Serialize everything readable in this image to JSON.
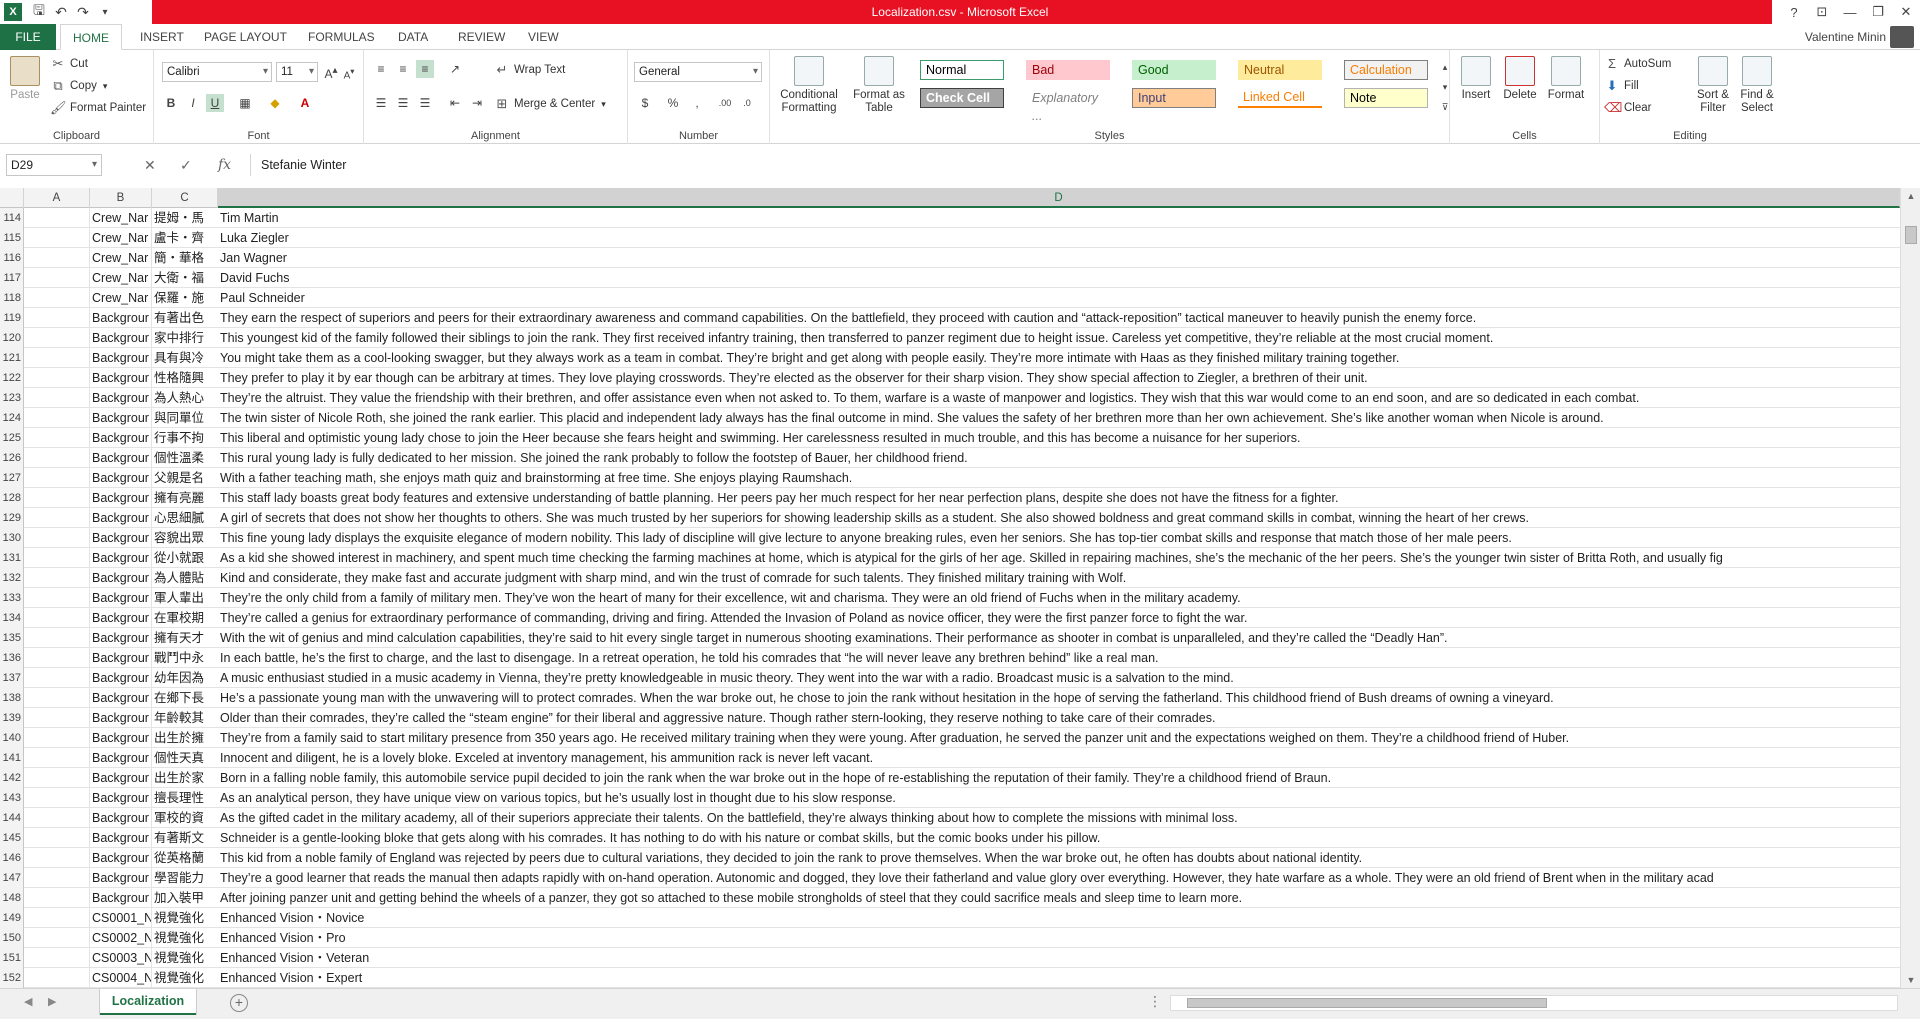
{
  "window": {
    "title": "Localization.csv - Microsoft Excel",
    "user_name": "Valentine Minin"
  },
  "ribbon_tabs": [
    "FILE",
    "HOME",
    "INSERT",
    "PAGE LAYOUT",
    "FORMULAS",
    "DATA",
    "REVIEW",
    "VIEW"
  ],
  "ribbon": {
    "clipboard": {
      "paste": "Paste",
      "cut": "Cut",
      "copy": "Copy",
      "format_painter": "Format Painter",
      "label": "Clipboard"
    },
    "font": {
      "name": "Calibri",
      "size": "11",
      "bold": "B",
      "italic": "I",
      "underline": "U",
      "label": "Font"
    },
    "alignment": {
      "wrap_text": "Wrap Text",
      "merge_center": "Merge & Center",
      "label": "Alignment"
    },
    "number": {
      "format": "General",
      "label": "Number"
    },
    "styles": {
      "conditional_formatting": "Conditional Formatting",
      "format_as_table": "Format as Table",
      "label": "Styles",
      "gallery": [
        {
          "name": "Normal",
          "bg": "#ffffff",
          "fg": "#000000",
          "border": "#3c9c6c"
        },
        {
          "name": "Bad",
          "bg": "#ffc7ce",
          "fg": "#9c0006",
          "border": "#ffc7ce"
        },
        {
          "name": "Good",
          "bg": "#c6efce",
          "fg": "#006100",
          "border": "#c6efce"
        },
        {
          "name": "Neutral",
          "bg": "#ffeb9c",
          "fg": "#9c5700",
          "border": "#ffeb9c"
        },
        {
          "name": "Calculation",
          "bg": "#f2f2f2",
          "fg": "#fa7d00",
          "border": "#7f7f7f"
        },
        {
          "name": "Check Cell",
          "bg": "#a5a5a5",
          "fg": "#ffffff",
          "border": "#3f3f3f"
        },
        {
          "name": "Explanatory ...",
          "bg": "#ffffff",
          "fg": "#7f7f7f",
          "border": "#ffffff"
        },
        {
          "name": "Input",
          "bg": "#ffcc99",
          "fg": "#3f3f76",
          "border": "#7f7f7f"
        },
        {
          "name": "Linked Cell",
          "bg": "#ffffff",
          "fg": "#fa7d00",
          "border": "#ff8001"
        },
        {
          "name": "Note",
          "bg": "#ffffcc",
          "fg": "#000000",
          "border": "#b2b2b2"
        }
      ]
    },
    "cells": {
      "insert": "Insert",
      "delete": "Delete",
      "format": "Format",
      "label": "Cells"
    },
    "editing": {
      "autosum": "AutoSum",
      "fill": "Fill",
      "clear": "Clear",
      "sort_filter": "Sort & Filter",
      "find_select": "Find & Select",
      "label": "Editing"
    }
  },
  "formula_bar": {
    "name_box": "D29",
    "fx": "fx",
    "content": "Stefanie Winter"
  },
  "columns": [
    "A",
    "B",
    "C",
    "D"
  ],
  "rows": [
    {
      "n": "114",
      "b": "Crew_Nar",
      "c": "提姆・馬",
      "d": "Tim Martin"
    },
    {
      "n": "115",
      "b": "Crew_Nar",
      "c": "盧卡・齊",
      "d": "Luka Ziegler"
    },
    {
      "n": "116",
      "b": "Crew_Nar",
      "c": "簡・華格",
      "d": "Jan Wagner"
    },
    {
      "n": "117",
      "b": "Crew_Nar",
      "c": "大衛・福",
      "d": "David Fuchs"
    },
    {
      "n": "118",
      "b": "Crew_Nar",
      "c": "保羅・施",
      "d": "Paul Schneider"
    },
    {
      "n": "119",
      "b": "Backgrour",
      "c": "有著出色",
      "d": "They earn the respect of superiors and peers for their extraordinary awareness and command capabilities.  On the battlefield, they proceed with caution and “attack-reposition” tactical maneuver to heavily punish the enemy force."
    },
    {
      "n": "120",
      "b": "Backgrour",
      "c": "家中排行",
      "d": "This youngest kid of the family followed their siblings to join the rank. They first received infantry training, then transferred to panzer regiment due to height issue.  Careless yet competitive, they’re reliable at the most crucial moment."
    },
    {
      "n": "121",
      "b": "Backgrour",
      "c": "具有與冷",
      "d": "You might take them as a cool-looking swagger, but they always work as a team in combat.  They’re bright and get along with people easily. They’re more intimate with Haas as they finished military training together."
    },
    {
      "n": "122",
      "b": "Backgrour",
      "c": "性格隨興",
      "d": "They prefer to play it by ear though can be arbitrary at times. They love playing crosswords.  They’re elected as the observer for their sharp vision.  They show special affection to Ziegler, a brethren of their unit."
    },
    {
      "n": "123",
      "b": "Backgrour",
      "c": "為人熱心",
      "d": "They’re the altruist. They value the friendship with their brethren, and offer assistance even when not asked to.  To them, warfare is a waste of manpower and logistics. They wish that this war would come to an end soon, and are so dedicated in each combat."
    },
    {
      "n": "124",
      "b": "Backgrour",
      "c": "與同單位",
      "d": "The twin sister of Nicole Roth, she joined the rank earlier.  This placid and independent lady always has the final outcome in mind. She values the safety of her brethren more than her own achievement.  She’s like another woman when Nicole is around."
    },
    {
      "n": "125",
      "b": "Backgrour",
      "c": "行事不拘",
      "d": "This liberal and optimistic young lady chose to join the Heer because she fears height and swimming.  Her carelessness resulted in much trouble, and this has become a nuisance for her superiors."
    },
    {
      "n": "126",
      "b": "Backgrour",
      "c": "個性溫柔",
      "d": "This rural young lady is fully dedicated to her mission.  She joined the rank probably to follow the footstep of Bauer, her childhood friend."
    },
    {
      "n": "127",
      "b": "Backgrour",
      "c": "父親是名",
      "d": "With a father teaching math, she enjoys math quiz and brainstorming at free time.  She enjoys playing Raumshach."
    },
    {
      "n": "128",
      "b": "Backgrour",
      "c": "擁有亮麗",
      "d": "This staff lady boasts great body features and extensive understanding of battle planning. Her peers pay her much respect for her near perfection plans, despite she does not have the fitness for a fighter."
    },
    {
      "n": "129",
      "b": "Backgrour",
      "c": "心思細膩",
      "d": "A girl of secrets that does not show her thoughts to others.  She was much trusted by her superiors for showing leadership skills as a student. She also showed boldness and great command skills in combat, winning the heart of her crews."
    },
    {
      "n": "130",
      "b": "Backgrour",
      "c": "容貌出眾",
      "d": "This fine young lady displays the exquisite elegance of modern nobility.  This lady of discipline will give lecture to anyone breaking rules, even her seniors.  She has top-tier combat skills and response that match those of her male peers."
    },
    {
      "n": "131",
      "b": "Backgrour",
      "c": "從小就跟",
      "d": "As a kid she showed interest in machinery, and spent much time checking the farming machines at home, which is atypical for the girls of her age.  Skilled in repairing machines, she’s the mechanic of the her peers.  She’s the younger twin sister of Britta Roth, and usually fig"
    },
    {
      "n": "132",
      "b": "Backgrour",
      "c": "為人體貼",
      "d": "Kind and considerate, they make fast and accurate judgment with sharp mind, and win the trust of comrade for such talents.  They finished military training with Wolf."
    },
    {
      "n": "133",
      "b": "Backgrour",
      "c": "軍人輩出",
      "d": "They’re the only child from a family of military men.  They’ve won the heart of many for their excellence, wit and charisma.  They were an old friend of Fuchs when in the military academy."
    },
    {
      "n": "134",
      "b": "Backgrour",
      "c": "在軍校期",
      "d": "They’re called a genius for extraordinary performance of commanding, driving and firing.  Attended the Invasion of Poland as novice officer, they were the first panzer force to fight the war."
    },
    {
      "n": "135",
      "b": "Backgrour",
      "c": "擁有天才",
      "d": "With the wit of genius and mind calculation capabilities, they’re said to hit every single target in numerous shooting examinations. Their performance as shooter in combat is unparalleled, and they’re called the “Deadly Han”."
    },
    {
      "n": "136",
      "b": "Backgrour",
      "c": "戰鬥中永",
      "d": "In each battle, he’s the first to charge, and the last to disengage.  In a retreat operation, he told his comrades that “he will never leave any brethren behind” like a real man."
    },
    {
      "n": "137",
      "b": "Backgrour",
      "c": "幼年因為",
      "d": "A music enthusiast studied in a music academy in Vienna, they’re pretty knowledgeable in music theory.  They went into the war with a radio. Broadcast music is a salvation to the mind."
    },
    {
      "n": "138",
      "b": "Backgrour",
      "c": "在鄉下長",
      "d": "He’s a passionate young man with the unwavering will to protect comrades.  When the war broke out, he chose to join the rank without hesitation in the hope of serving the fatherland.  This childhood friend of Bush dreams of owning a vineyard."
    },
    {
      "n": "139",
      "b": "Backgrour",
      "c": "年齡較其",
      "d": "Older than their comrades, they’re called the “steam engine” for their liberal and aggressive nature.  Though rather stern-looking, they reserve nothing to take care of their comrades."
    },
    {
      "n": "140",
      "b": "Backgrour",
      "c": "出生於擁",
      "d": "They’re from a family said to start military presence from 350 years ago.  He received military training when they were young. After graduation, he served the panzer unit and the expectations weighed on them.  They’re a childhood friend of Huber."
    },
    {
      "n": "141",
      "b": "Backgrour",
      "c": "個性天真",
      "d": "Innocent and diligent, he is a lovely bloke.  Exceled at inventory management, his ammunition rack is never left vacant."
    },
    {
      "n": "142",
      "b": "Backgrour",
      "c": "出生於家",
      "d": "Born in a falling noble family, this automobile service pupil decided to join the rank when the war broke out in the hope of re-establishing the reputation of their family.  They’re a childhood friend of Braun."
    },
    {
      "n": "143",
      "b": "Backgrour",
      "c": "擅長理性",
      "d": "As an analytical person, they have unique view on various topics, but he’s usually lost in thought due to his slow response."
    },
    {
      "n": "144",
      "b": "Backgrour",
      "c": "軍校的資",
      "d": "As the gifted cadet in the military academy, all of their superiors appreciate their talents. On the battlefield, they’re always thinking about how to complete the missions with minimal loss."
    },
    {
      "n": "145",
      "b": "Backgrour",
      "c": "有著斯文",
      "d": "Schneider is a gentle-looking bloke that gets along with his comrades. It has nothing to do with his nature or combat skills, but the comic books under his pillow."
    },
    {
      "n": "146",
      "b": "Backgrour",
      "c": "從英格蘭",
      "d": "This kid from a noble family of England was rejected by peers due to cultural variations, they decided to join the rank to prove themselves.  When the war broke out, he often has doubts about national identity."
    },
    {
      "n": "147",
      "b": "Backgrour",
      "c": "學習能力",
      "d": "They’re a good learner that reads the manual then adapts rapidly with on-hand operation.  Autonomic and dogged, they love their fatherland and value glory over everything. However, they hate warfare as a whole.  They were an old friend of Brent when in the military acad"
    },
    {
      "n": "148",
      "b": "Backgrour",
      "c": "加入裝甲",
      "d": "After joining panzer unit and getting behind the wheels of a panzer, they got so attached to these mobile strongholds of steel that they could sacrifice meals and sleep time to learn more."
    },
    {
      "n": "149",
      "b": "CS0001_N",
      "c": "視覺強化",
      "d": "Enhanced Vision・Novice"
    },
    {
      "n": "150",
      "b": "CS0002_N",
      "c": "視覺強化",
      "d": "Enhanced Vision・Pro"
    },
    {
      "n": "151",
      "b": "CS0003_N",
      "c": "視覺強化",
      "d": "Enhanced Vision・Veteran"
    },
    {
      "n": "152",
      "b": "CS0004_N",
      "c": "視覺強化",
      "d": "Enhanced Vision・Expert"
    }
  ],
  "sheet_tab": "Localization",
  "colors": {
    "excel_green": "#217346",
    "title_red": "#e81123"
  }
}
